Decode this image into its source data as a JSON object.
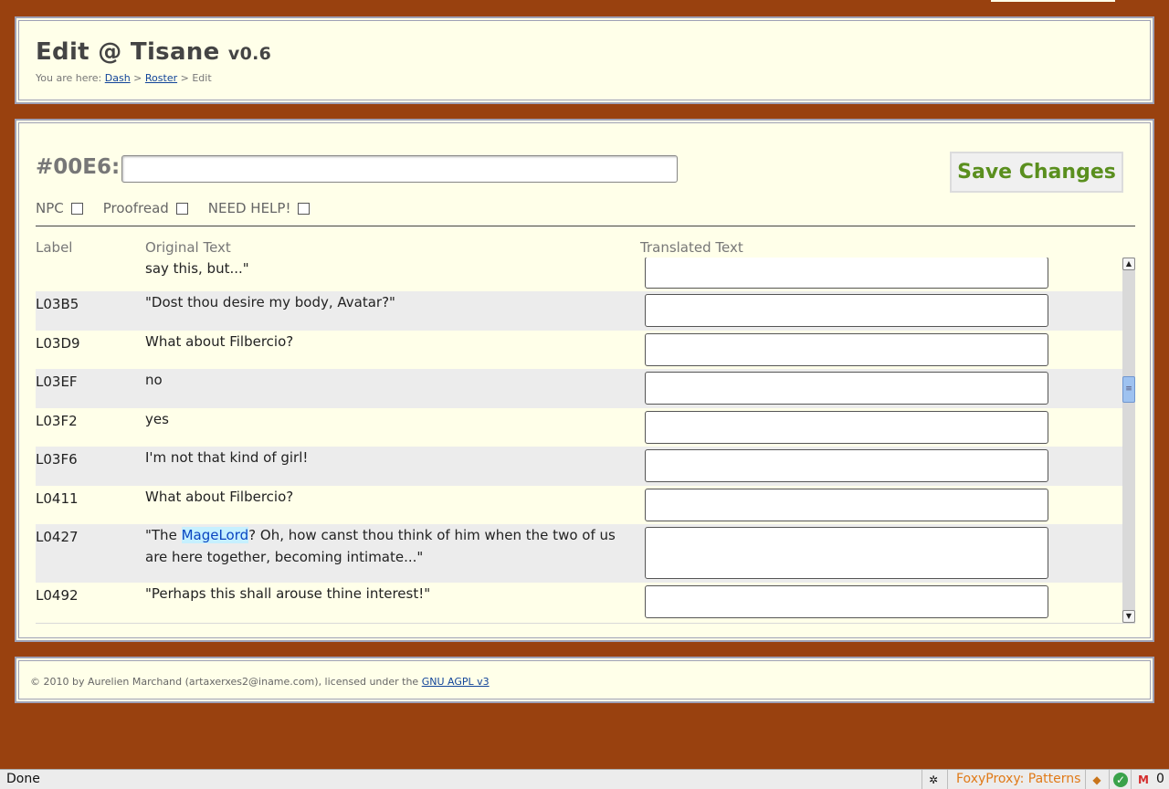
{
  "header": {
    "title": "Edit @ Tisane",
    "version": "v0.6",
    "breadcrumb_prefix": "You are here:",
    "crumb_dash": "Dash",
    "crumb_roster": "Roster",
    "crumb_current": "Edit",
    "separator": ">"
  },
  "editor": {
    "entry_id": "#00E6:",
    "name_value": "",
    "save_label": "Save Changes",
    "flags": [
      {
        "label": "NPC",
        "checked": false
      },
      {
        "label": "Proofread",
        "checked": false
      },
      {
        "label": "NEED HELP!",
        "checked": false
      }
    ],
    "columns": {
      "label": "Label",
      "original": "Original Text",
      "translated": "Translated Text"
    }
  },
  "rows": [
    {
      "label": "",
      "original": "say this, but...\""
    },
    {
      "label": "L03B5",
      "original": "\"Dost thou desire my body, Avatar?\""
    },
    {
      "label": "L03D9",
      "original": "What about Filbercio?"
    },
    {
      "label": "L03EF",
      "original": "no"
    },
    {
      "label": "L03F2",
      "original": "yes"
    },
    {
      "label": "L03F6",
      "original": "I'm not that kind of girl!"
    },
    {
      "label": "L0411",
      "original": "What about Filbercio?"
    },
    {
      "label": "L0427",
      "original_before": "\"The ",
      "original_highlight": "MageLord",
      "original_after": "? Oh, how canst thou think of him when the two of us are here together, becoming intimate...\""
    },
    {
      "label": "L0492",
      "original": "\"Perhaps this shall arouse thine interest!\""
    }
  ],
  "footer": {
    "copyright": "© 2010 by Aurelien Marchand (artaxerxes2@iname.com), licensed under the",
    "license_link": "GNU AGPL v3"
  },
  "statusbar": {
    "status": "Done",
    "foxyproxy": "FoxyProxy: Patterns",
    "mail_count": "0"
  },
  "colors": {
    "background": "#99410f",
    "panel": "#ffffe9",
    "row_alt": "#ececec",
    "save_text": "#5a8f1e",
    "link": "#114499"
  }
}
